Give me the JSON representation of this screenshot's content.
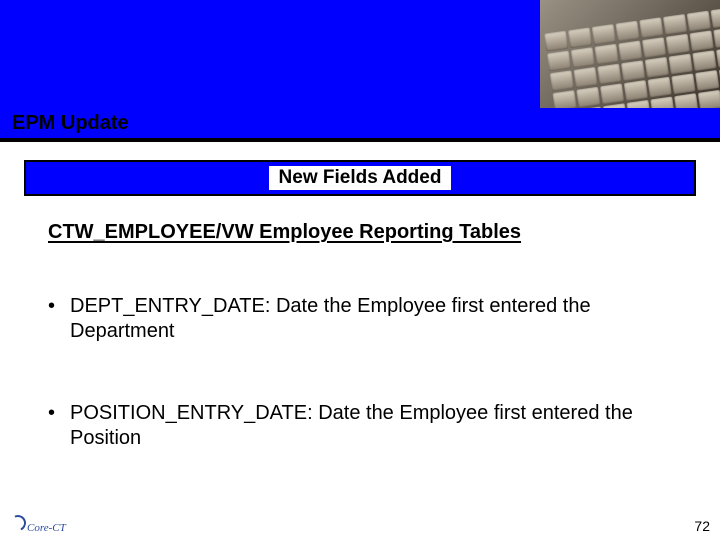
{
  "header": {
    "title": "EPM Update"
  },
  "section": {
    "band_label": "New Fields Added"
  },
  "content": {
    "subtitle": "CTW_EMPLOYEE/VW Employee Reporting Tables",
    "bullets": [
      "DEPT_ENTRY_DATE:  Date the Employee first entered the Department",
      "POSITION_ENTRY_DATE:  Date the Employee first entered the Position"
    ]
  },
  "footer": {
    "logo_text": "Core-",
    "logo_suffix": "CT",
    "page_number": "72"
  }
}
